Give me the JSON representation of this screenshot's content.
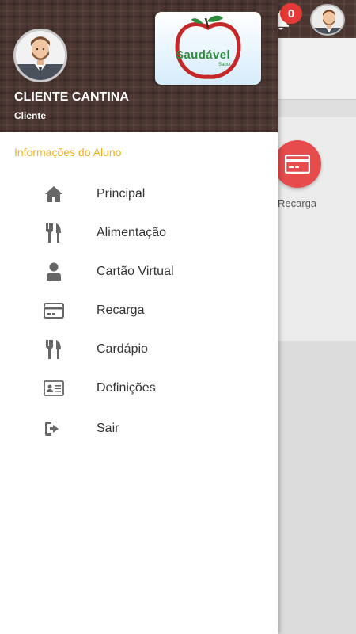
{
  "background": {
    "notification_count": "0",
    "recarga_label": "Recarga"
  },
  "drawer": {
    "header": {
      "name": "CLIENTE CANTINA",
      "role": "Cliente",
      "logo_text": "Saudável",
      "logo_subtext": "Sabor"
    },
    "section_title": "Informações do Aluno",
    "items": [
      {
        "label": "Principal",
        "icon": "home-icon"
      },
      {
        "label": "Alimentação",
        "icon": "fork-knife-icon"
      },
      {
        "label": "Cartão Virtual",
        "icon": "person-icon"
      },
      {
        "label": "Recarga",
        "icon": "credit-card-icon"
      },
      {
        "label": "Cardápio",
        "icon": "fork-knife-icon"
      },
      {
        "label": "Definições",
        "icon": "id-card-icon"
      },
      {
        "label": "Sair",
        "icon": "logout-icon"
      }
    ]
  },
  "colors": {
    "header_brown": "#4c3631",
    "section_title": "#f2b11d",
    "recarga_button": "#e74c4c",
    "badge": "#e53935",
    "icon_gray": "#666666"
  }
}
